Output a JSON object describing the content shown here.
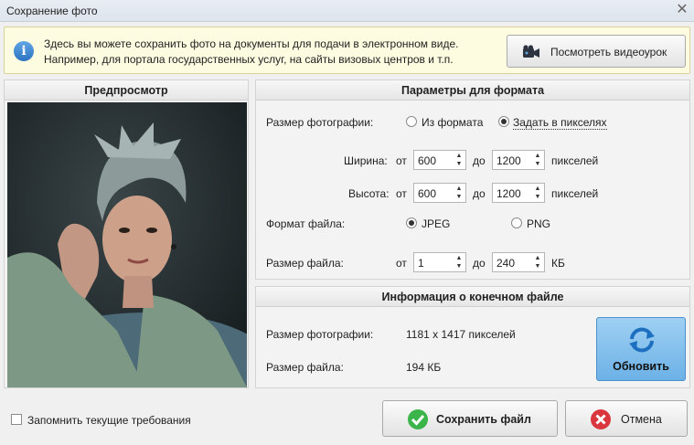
{
  "window": {
    "title": "Сохранение фото",
    "close_symbol": "✕"
  },
  "info": {
    "line1": "Здесь вы можете сохранить фото на документы для подачи в электронном виде.",
    "line2": "Например, для портала государственных услуг, на сайты визовых центров и т.п.",
    "video_button": "Посмотреть видеоурок",
    "icon": "info-icon"
  },
  "preview": {
    "title": "Предпросмотр"
  },
  "params": {
    "title": "Параметры для формата",
    "photo_size_label": "Размер фотографии:",
    "option_from_format": "Из формата",
    "option_set_pixels": "Задать в пикселях",
    "selected_size_option": "Задать в пикселях",
    "width_label": "Ширина:",
    "height_label": "Высота:",
    "from": "от",
    "to": "до",
    "pixels": "пикселей",
    "width_from": "600",
    "width_to": "1200",
    "height_from": "600",
    "height_to": "1200",
    "format_label": "Формат файла:",
    "format_jpeg": "JPEG",
    "format_png": "PNG",
    "selected_format": "JPEG",
    "filesize_label": "Размер файла:",
    "filesize_from": "1",
    "filesize_to": "240",
    "kb": "КБ"
  },
  "result": {
    "title": "Информация о конечном файле",
    "photo_size_label": "Размер фотографии:",
    "photo_size_value": "1181 x 1417 пикселей",
    "filesize_label": "Размер файла:",
    "filesize_value": "194 КБ",
    "refresh_button": "Обновить"
  },
  "footer": {
    "remember_label": "Запомнить текущие требования",
    "remember_checked": false,
    "save_button": "Сохранить файл",
    "cancel_button": "Отмена"
  },
  "colors": {
    "accent_button": "#7dbdea",
    "info_background": "#fdfbe0",
    "save_icon": "#3bb44a",
    "cancel_icon": "#d9363e"
  }
}
